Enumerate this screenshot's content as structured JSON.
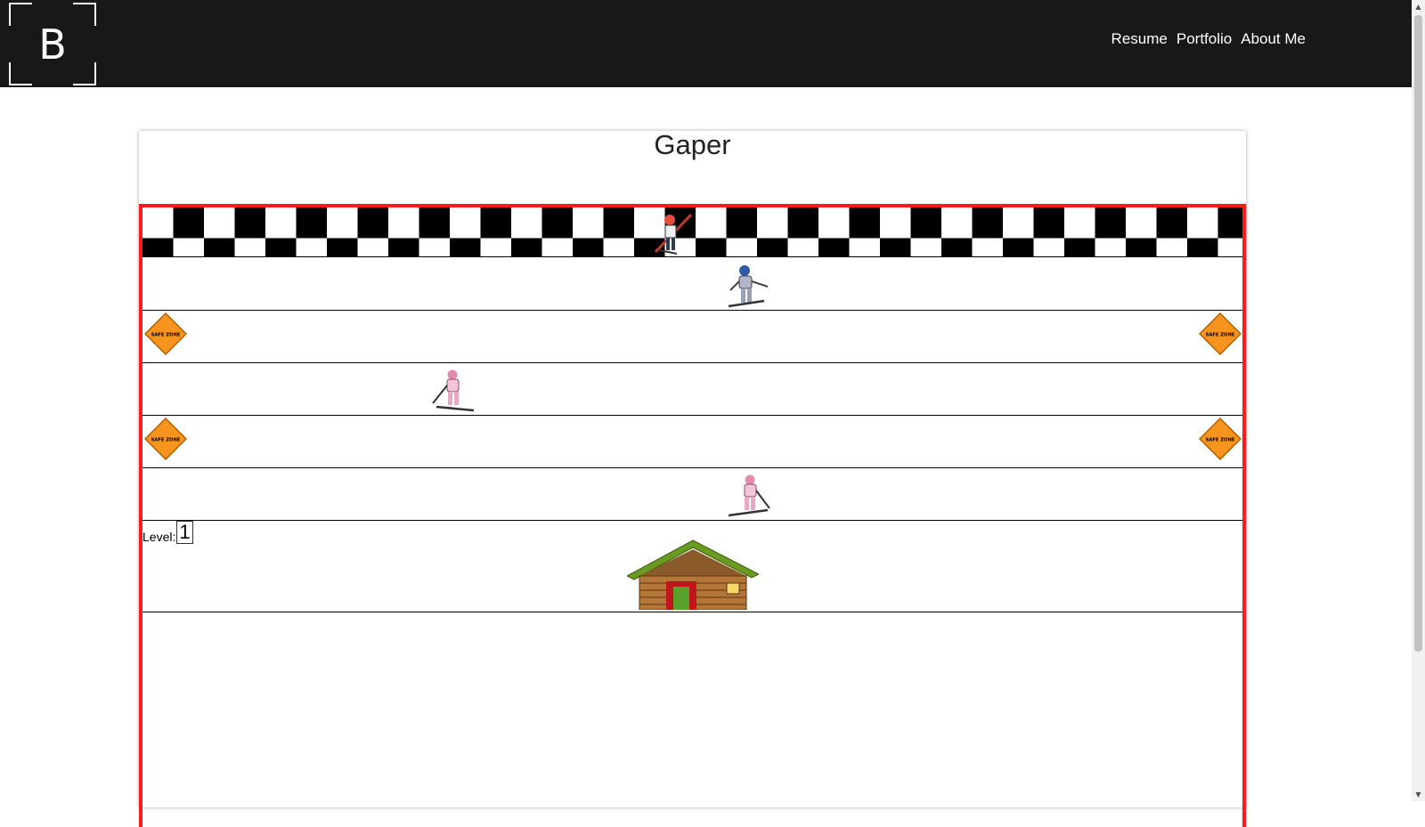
{
  "header": {
    "logo_letter": "B",
    "nav": [
      "Resume",
      "Portfolio",
      "About Me"
    ]
  },
  "game": {
    "title": "Gaper",
    "level_label": "Level:",
    "level_value": "1",
    "safe_zone_text": "SAFE ZONE",
    "colors": {
      "border": "#ff1a1a",
      "sign": "#f7941d",
      "header": "#181818"
    }
  }
}
